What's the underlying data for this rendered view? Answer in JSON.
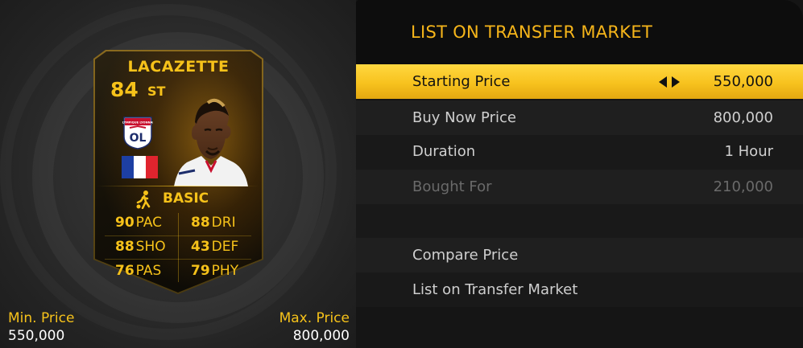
{
  "header": {
    "title": "LIST ON TRANSFER MARKET"
  },
  "card": {
    "name": "LACAZETTE",
    "rating": "84",
    "position": "ST",
    "club_badge_text": "OLYMPIQUE LYONNAIS",
    "club_badge_initials": "OL",
    "nation_icon": "france-flag-icon",
    "chemistry_icon": "player-silhouette-icon",
    "chemistry_style": "BASIC",
    "stats": [
      {
        "value": "90",
        "label": "PAC"
      },
      {
        "value": "88",
        "label": "DRI"
      },
      {
        "value": "88",
        "label": "SHO"
      },
      {
        "value": "43",
        "label": "DEF"
      },
      {
        "value": "76",
        "label": "PAS"
      },
      {
        "value": "79",
        "label": "PHY"
      }
    ]
  },
  "prices": {
    "min_label": "Min. Price",
    "min_value": "550,000",
    "max_label": "Max. Price",
    "max_value": "800,000"
  },
  "menu": {
    "starting_price": {
      "label": "Starting Price",
      "value": "550,000"
    },
    "buy_now_price": {
      "label": "Buy Now Price",
      "value": "800,000"
    },
    "duration": {
      "label": "Duration",
      "value": "1 Hour"
    },
    "bought_for": {
      "label": "Bought For",
      "value": "210,000"
    },
    "compare_price": {
      "label": "Compare Price"
    },
    "list_on_market": {
      "label": "List on Transfer Market"
    }
  },
  "colors": {
    "accent": "#f6c21a",
    "selected_row": "#f7c21e",
    "background": "#151515"
  }
}
